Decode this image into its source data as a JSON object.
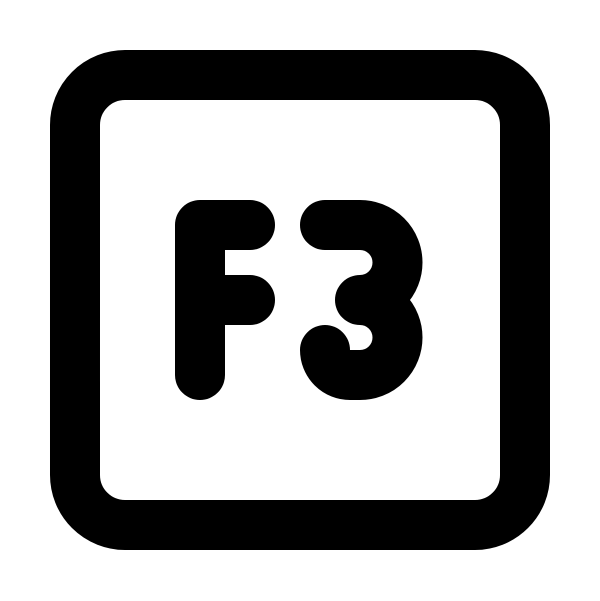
{
  "icon": {
    "name": "f3-key-icon",
    "key_label": "F3",
    "stroke_color": "#000000",
    "background_color": "#ffffff"
  }
}
